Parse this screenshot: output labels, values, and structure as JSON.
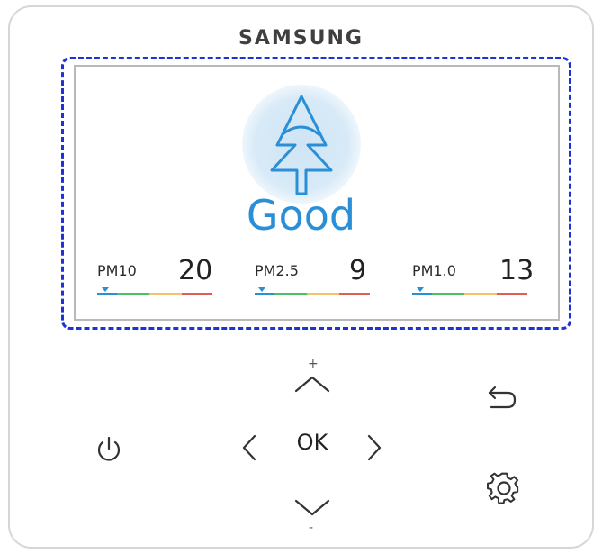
{
  "brand": "SAMSUNG",
  "screen": {
    "status": "Good",
    "status_color": "#2a8fd6",
    "icon": "tree-icon",
    "readings": [
      {
        "label": "PM10",
        "value": "20"
      },
      {
        "label": "PM2.5",
        "value": "9"
      },
      {
        "label": "PM1.0",
        "value": "13"
      }
    ],
    "scale_colors": [
      "#2a8fd6",
      "#4cbf6a",
      "#f2c36b",
      "#e25b5b"
    ]
  },
  "controls": {
    "plus_label": "+",
    "minus_label": "-",
    "ok_label": "OK",
    "icons": [
      "power-icon",
      "chevron-up-icon",
      "chevron-down-icon",
      "chevron-left-icon",
      "chevron-right-icon",
      "back-arrow-icon",
      "gear-icon"
    ]
  },
  "colors": {
    "focus_outline": "#1e33d6",
    "accent": "#2a8fd6"
  }
}
